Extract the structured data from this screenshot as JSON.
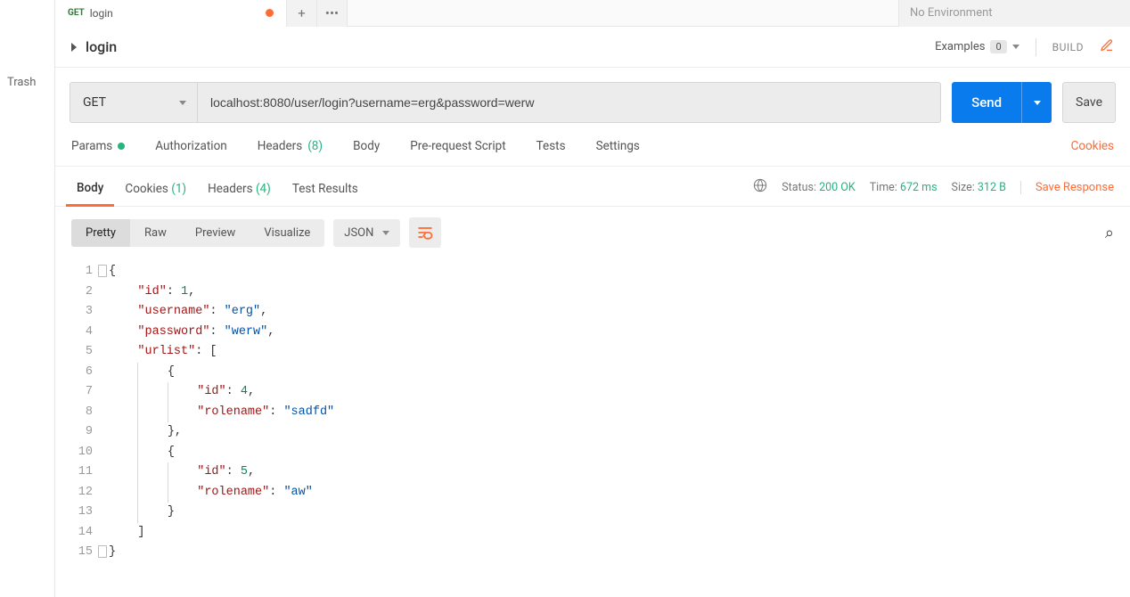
{
  "sidebar": {
    "trash": "Trash"
  },
  "tabbar": {
    "tab_method": "GET",
    "tab_title": "login",
    "env_placeholder": "No Environment"
  },
  "request": {
    "name": "login",
    "examples_label": "Examples",
    "examples_count": "0",
    "build_label": "BUILD",
    "method": "GET",
    "url": "localhost:8080/user/login?username=erg&password=werw",
    "send_label": "Send",
    "save_label": "Save"
  },
  "req_tabs": {
    "params": "Params",
    "authorization": "Authorization",
    "headers": "Headers",
    "headers_count": "(8)",
    "body": "Body",
    "prerequest": "Pre-request Script",
    "tests": "Tests",
    "settings": "Settings",
    "cookies": "Cookies"
  },
  "resp_tabs": {
    "body": "Body",
    "cookies": "Cookies",
    "cookies_count": "(1)",
    "headers": "Headers",
    "headers_count": "(4)",
    "test_results": "Test Results"
  },
  "resp_meta": {
    "status_label": "Status:",
    "status_value": "200 OK",
    "time_label": "Time:",
    "time_value": "672 ms",
    "size_label": "Size:",
    "size_value": "312 B",
    "save_response": "Save Response"
  },
  "format": {
    "pretty": "Pretty",
    "raw": "Raw",
    "preview": "Preview",
    "visualize": "Visualize",
    "lang": "JSON"
  },
  "response_body": {
    "id": 1,
    "username": "erg",
    "password": "werw",
    "urlist": [
      {
        "id": 4,
        "rolename": "sadfd"
      },
      {
        "id": 5,
        "rolename": "aw"
      }
    ]
  },
  "code_lines": [
    [
      1,
      [
        [
          "p",
          "{"
        ]
      ]
    ],
    [
      2,
      [
        [
          "k",
          "    \"id\""
        ],
        [
          "p",
          ": "
        ],
        [
          "n",
          "1"
        ],
        [
          "p",
          ","
        ]
      ]
    ],
    [
      3,
      [
        [
          "k",
          "    \"username\""
        ],
        [
          "p",
          ": "
        ],
        [
          "s",
          "\"erg\""
        ],
        [
          "p",
          ","
        ]
      ]
    ],
    [
      4,
      [
        [
          "k",
          "    \"password\""
        ],
        [
          "p",
          ": "
        ],
        [
          "s",
          "\"werw\""
        ],
        [
          "p",
          ","
        ]
      ]
    ],
    [
      5,
      [
        [
          "k",
          "    \"urlist\""
        ],
        [
          "p",
          ": ["
        ]
      ]
    ],
    [
      6,
      [
        [
          "p",
          "        {"
        ]
      ]
    ],
    [
      7,
      [
        [
          "k",
          "            \"id\""
        ],
        [
          "p",
          ": "
        ],
        [
          "n",
          "4"
        ],
        [
          "p",
          ","
        ]
      ]
    ],
    [
      8,
      [
        [
          "k",
          "            \"rolename\""
        ],
        [
          "p",
          ": "
        ],
        [
          "s",
          "\"sadfd\""
        ]
      ]
    ],
    [
      9,
      [
        [
          "p",
          "        },"
        ]
      ]
    ],
    [
      10,
      [
        [
          "p",
          "        {"
        ]
      ]
    ],
    [
      11,
      [
        [
          "k",
          "            \"id\""
        ],
        [
          "p",
          ": "
        ],
        [
          "n",
          "5"
        ],
        [
          "p",
          ","
        ]
      ]
    ],
    [
      12,
      [
        [
          "k",
          "            \"rolename\""
        ],
        [
          "p",
          ": "
        ],
        [
          "s",
          "\"aw\""
        ]
      ]
    ],
    [
      13,
      [
        [
          "p",
          "        }"
        ]
      ]
    ],
    [
      14,
      [
        [
          "p",
          "    ]"
        ]
      ]
    ],
    [
      15,
      [
        [
          "p",
          "}"
        ]
      ]
    ]
  ]
}
